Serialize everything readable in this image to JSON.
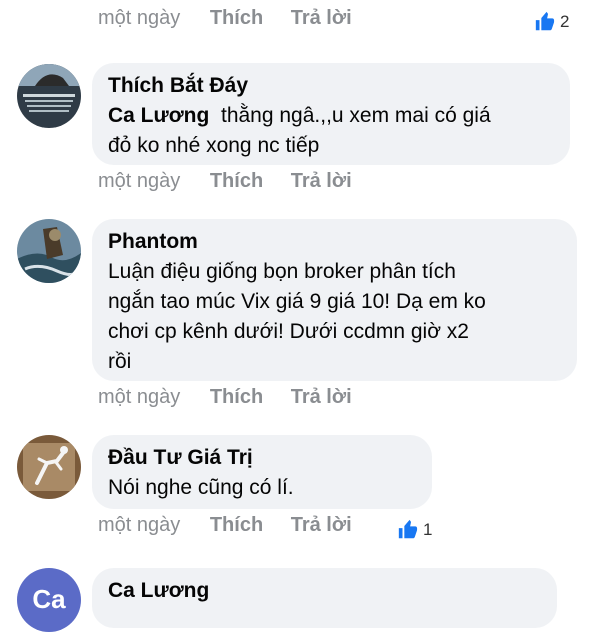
{
  "top_actions": {
    "time": "một ngày",
    "like": "Thích",
    "reply": "Trả lời",
    "reaction_count": "2"
  },
  "comments": [
    {
      "author": "Thích Bắt Đáy",
      "mention": "Ca Lương",
      "text_line1": "  thằng ngâ.,,u xem mai có giá",
      "text_line2": "đỏ ko nhé xong nc tiếp",
      "time": "một ngày",
      "like": "Thích",
      "reply": "Trả lời"
    },
    {
      "author": "Phantom",
      "lines": [
        "Luận điệu giống bọn broker phân tích",
        "ngắn tao múc Vix giá 9 giá 10!  Dạ em ko",
        "chơi cp kênh dưới!  Dưới ccdmn giờ x2",
        "rồi"
      ],
      "time": "một ngày",
      "like": "Thích",
      "reply": "Trả lời"
    },
    {
      "author": "Đầu Tư Giá Trị",
      "lines": [
        "Nói nghe cũng có lí."
      ],
      "time": "một ngày",
      "like": "Thích",
      "reply": "Trả lời",
      "reaction_count": "1"
    },
    {
      "author": "Ca Lương",
      "avatar_initials": "Ca"
    }
  ],
  "colors": {
    "like_blue": "#1877f2",
    "bubble": "#f0f2f5",
    "meta": "#8a8d91",
    "avatar_purple": "#5b6bc7"
  }
}
